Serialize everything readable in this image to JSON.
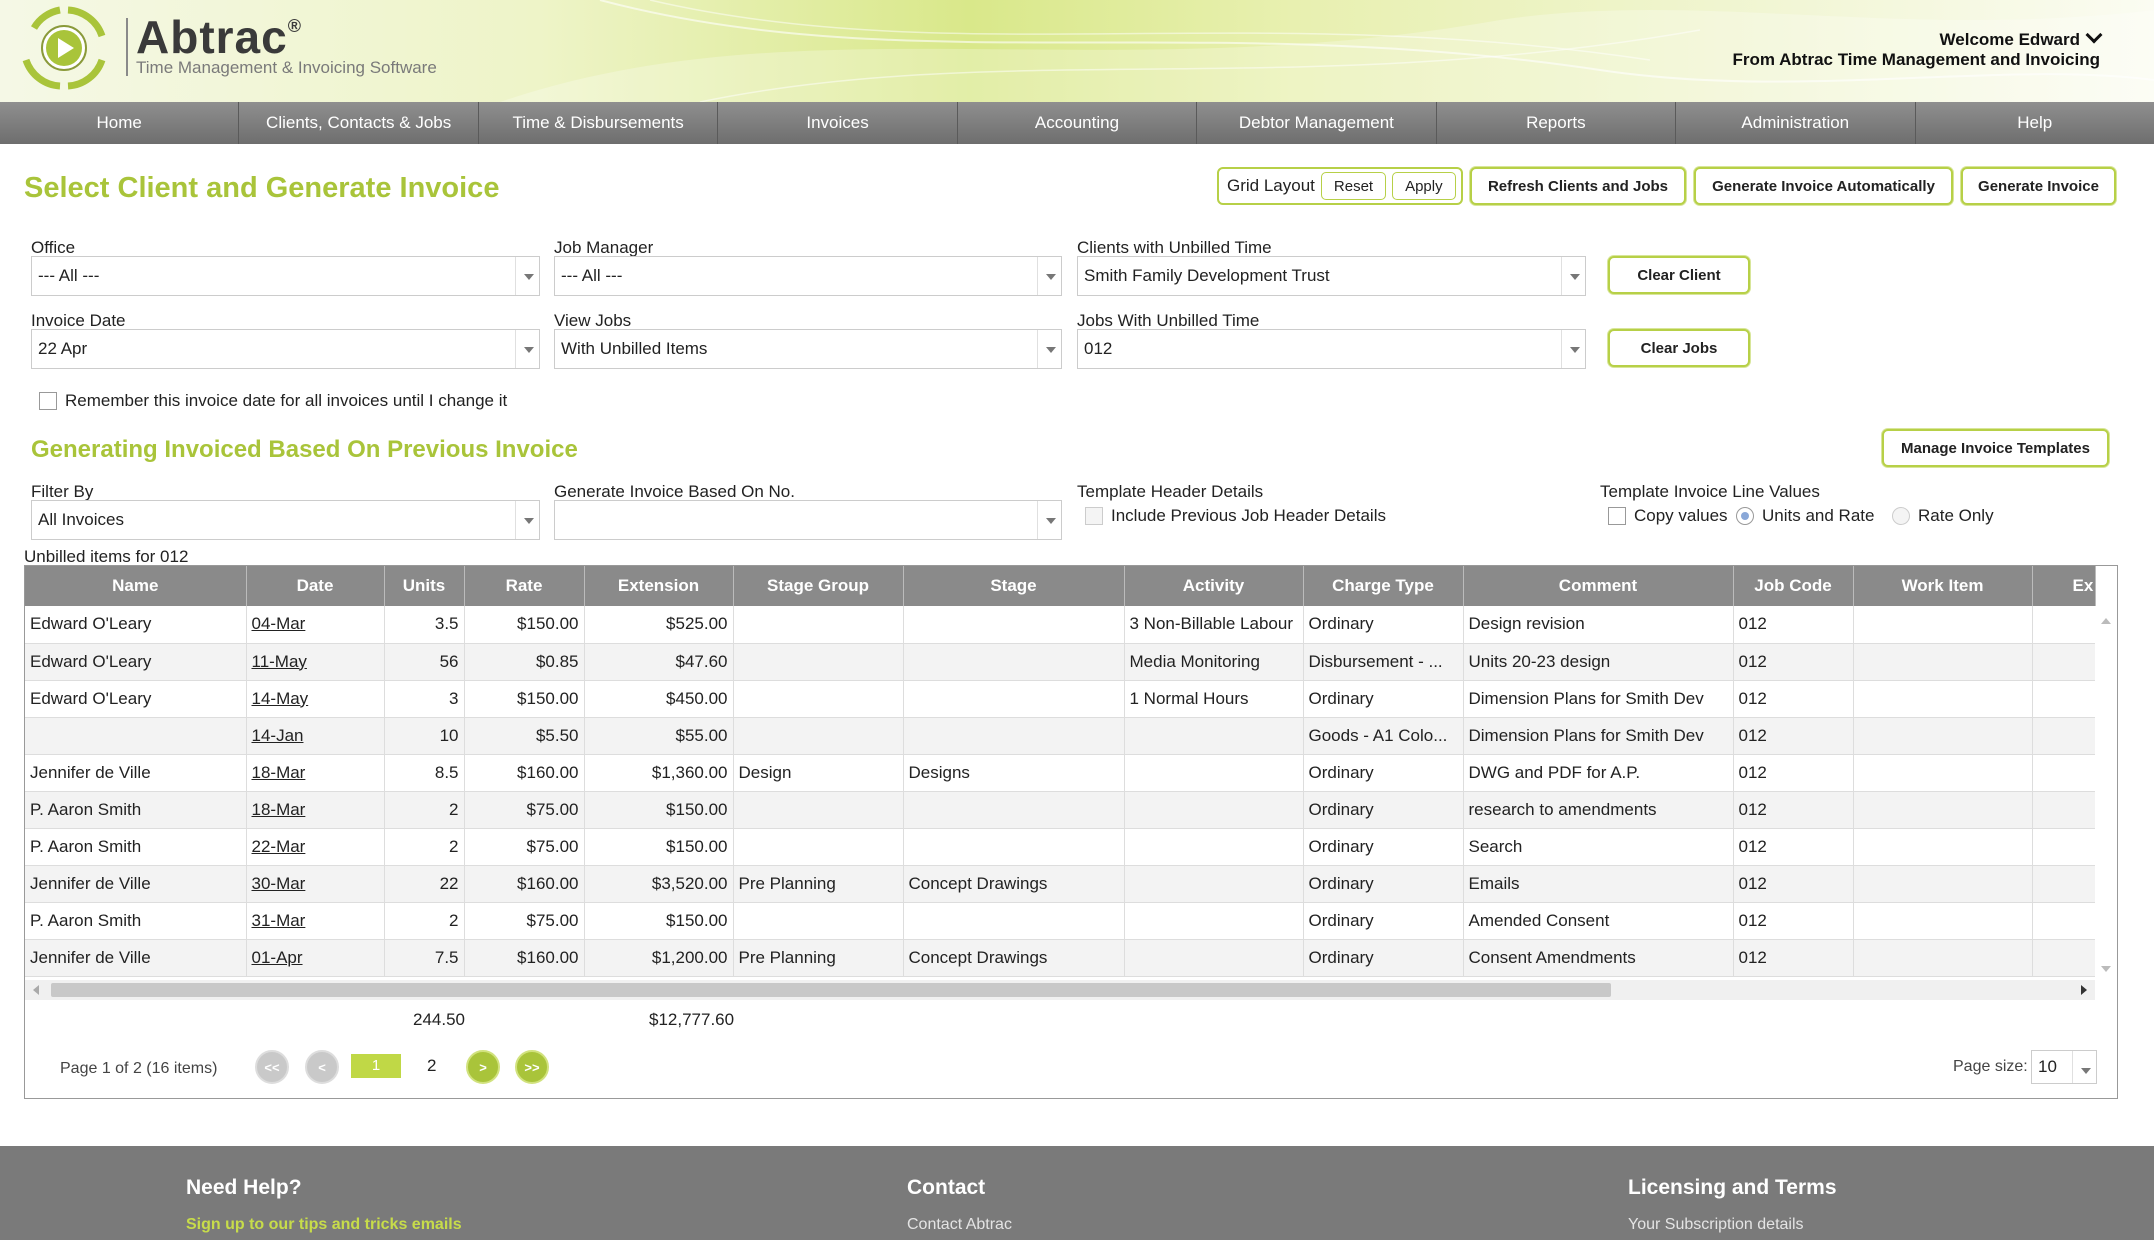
{
  "brand": {
    "name": "Abtrac",
    "reg": "®",
    "tagline": "Time Management & Invoicing Software"
  },
  "header": {
    "welcome": "Welcome Edward",
    "from": "From Abtrac Time Management and Invoicing"
  },
  "nav": [
    "Home",
    "Clients, Contacts & Jobs",
    "Time & Disbursements",
    "Invoices",
    "Accounting",
    "Debtor Management",
    "Reports",
    "Administration",
    "Help"
  ],
  "page": {
    "title": "Select Client and Generate Invoice",
    "grid_layout_label": "Grid Layout",
    "reset_label": "Reset",
    "apply_label": "Apply",
    "refresh_label": "Refresh Clients and Jobs",
    "generate_auto_label": "Generate Invoice Automatically",
    "generate_label": "Generate Invoice"
  },
  "filters": {
    "office_label": "Office",
    "office_value": "--- All ---",
    "job_manager_label": "Job Manager",
    "job_manager_value": "--- All ---",
    "clients_label": "Clients with Unbilled Time",
    "clients_value": "Smith Family Development Trust",
    "clear_client_label": "Clear Client",
    "invoice_date_label": "Invoice Date",
    "invoice_date_value": "22 Apr",
    "view_jobs_label": "View Jobs",
    "view_jobs_value": "With Unbilled Items",
    "jobs_label": "Jobs With Unbilled Time",
    "jobs_value": "012",
    "clear_jobs_label": "Clear Jobs",
    "remember_label": "Remember this invoice date for all invoices until I change it"
  },
  "previous": {
    "title": "Generating Invoiced Based On Previous Invoice",
    "manage_templates_label": "Manage Invoice Templates",
    "filter_by_label": "Filter By",
    "filter_by_value": "All Invoices",
    "based_on_label": "Generate Invoice Based On No.",
    "based_on_value": "",
    "template_header_label": "Template Header Details",
    "include_header_label": "Include Previous Job Header Details",
    "line_values_label": "Template Invoice Line Values",
    "copy_values_label": "Copy values",
    "units_rate_label": "Units and Rate",
    "rate_only_label": "Rate Only"
  },
  "grid": {
    "caption": "Unbilled items for 012",
    "columns": [
      "Name",
      "Date",
      "Units",
      "Rate",
      "Extension",
      "Stage Group",
      "Stage",
      "Activity",
      "Charge Type",
      "Comment",
      "Job Code",
      "Work Item",
      "Ex"
    ],
    "rows": [
      [
        "Edward O'Leary",
        "04-Mar",
        "3.5",
        "$150.00",
        "$525.00",
        "",
        "",
        "3 Non-Billable Labour",
        "Ordinary",
        "Design revision",
        "012",
        ""
      ],
      [
        "Edward O'Leary",
        "11-May",
        "56",
        "$0.85",
        "$47.60",
        "",
        "",
        "Media Monitoring",
        "Disbursement - ...",
        "Units 20-23 design",
        "012",
        ""
      ],
      [
        "Edward O'Leary",
        "14-May",
        "3",
        "$150.00",
        "$450.00",
        "",
        "",
        "1 Normal Hours",
        "Ordinary",
        "Dimension Plans for Smith Dev",
        "012",
        ""
      ],
      [
        "",
        "14-Jan",
        "10",
        "$5.50",
        "$55.00",
        "",
        "",
        "",
        "Goods - A1 Colo...",
        "Dimension Plans for Smith Dev",
        "012",
        ""
      ],
      [
        "Jennifer de Ville",
        "18-Mar",
        "8.5",
        "$160.00",
        "$1,360.00",
        "Design",
        "Designs",
        "",
        "Ordinary",
        "DWG and PDF for A.P.",
        "012",
        ""
      ],
      [
        "P. Aaron Smith",
        "18-Mar",
        "2",
        "$75.00",
        "$150.00",
        "",
        "",
        "",
        "Ordinary",
        "research to amendments",
        "012",
        ""
      ],
      [
        "P. Aaron Smith",
        "22-Mar",
        "2",
        "$75.00",
        "$150.00",
        "",
        "",
        "",
        "Ordinary",
        "Search",
        "012",
        ""
      ],
      [
        "Jennifer de Ville",
        "30-Mar",
        "22",
        "$160.00",
        "$3,520.00",
        "Pre Planning",
        "Concept Drawings",
        "",
        "Ordinary",
        "Emails",
        "012",
        ""
      ],
      [
        "P. Aaron Smith",
        "31-Mar",
        "2",
        "$75.00",
        "$150.00",
        "",
        "",
        "",
        "Ordinary",
        "Amended Consent",
        "012",
        ""
      ],
      [
        "Jennifer de Ville",
        "01-Apr",
        "7.5",
        "$160.00",
        "$1,200.00",
        "Pre Planning",
        "Concept Drawings",
        "",
        "Ordinary",
        "Consent Amendments",
        "012",
        ""
      ]
    ],
    "total_units": "244.50",
    "total_extension": "$12,777.60",
    "page_info": "Page 1 of 2 (16 items)",
    "page_current": "1",
    "page_next": "2",
    "page_size_label": "Page size:",
    "page_size_value": "10"
  },
  "footer": {
    "help_title": "Need Help?",
    "help_link": "Sign up to our tips and tricks emails",
    "contact_title": "Contact",
    "contact_link": "Contact Abtrac",
    "license_title": "Licensing and Terms",
    "license_link": "Your Subscription details"
  },
  "colors": {
    "accent": "#a9c43a",
    "nav": "#7a7a7a",
    "grid_header": "#8a8a8a"
  }
}
